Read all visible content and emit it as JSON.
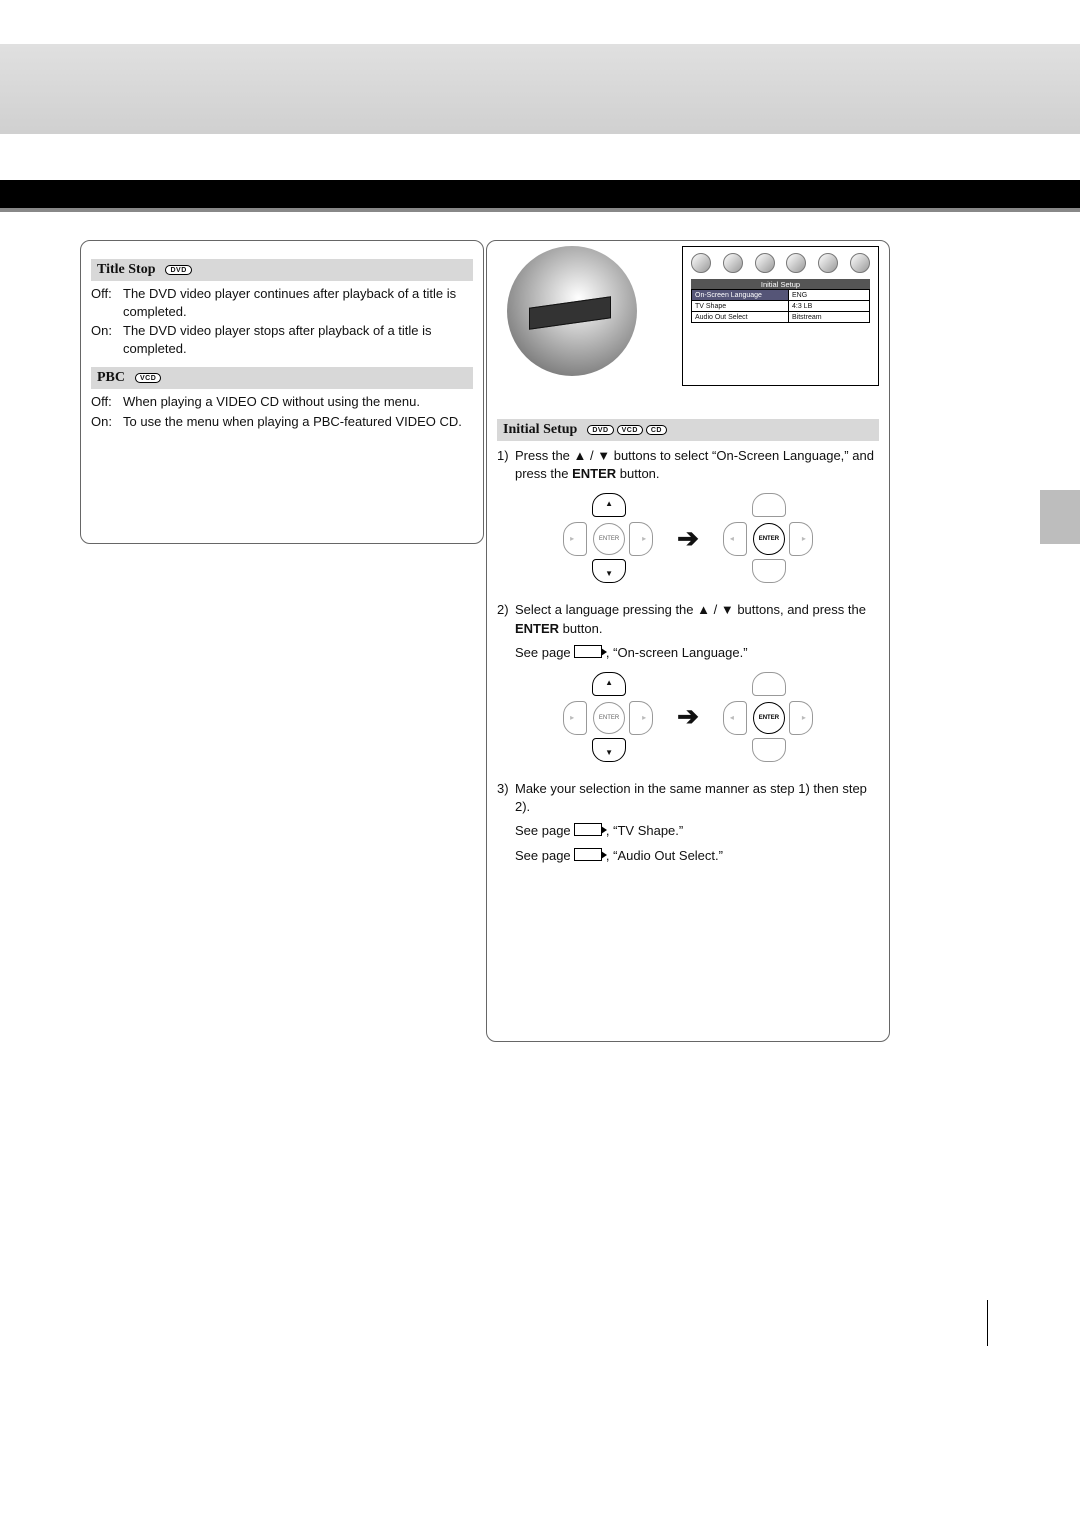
{
  "left": {
    "titleStop": {
      "label": "Title Stop",
      "badges": [
        "DVD"
      ],
      "off": "The DVD video player continues after playback of a title is completed.",
      "on": "The DVD video player stops after playback of a title is completed."
    },
    "pbc": {
      "label": "PBC",
      "badges": [
        "VCD"
      ],
      "off": "When playing a VIDEO CD without using the menu.",
      "on": "To use the menu when playing a PBC-featured VIDEO CD."
    }
  },
  "right": {
    "menu": {
      "title": "Initial Setup",
      "rows": [
        {
          "label": "On-Screen Language",
          "value": "ENG",
          "hl": true
        },
        {
          "label": "TV Shape",
          "value": "4:3 LB"
        },
        {
          "label": "Audio Out Select",
          "value": "Bitstream"
        }
      ]
    },
    "section": {
      "label": "Initial Setup",
      "badges": [
        "DVD",
        "VCD",
        "CD"
      ]
    },
    "step1": {
      "num": "1)",
      "pre": "Press the ",
      "mid": " buttons to select ",
      "item": "On-Screen Language,",
      "post": " and press the ",
      "btn": "ENTER",
      "tail": " button."
    },
    "step2": {
      "num": "2)",
      "pre": "Select a language pressing the ",
      "mid": " buttons, and press the ",
      "btn": "ENTER",
      "tail": " button.",
      "ref": "On-screen Language."
    },
    "step3": {
      "num": "3)",
      "text": "Make your selection in the same manner as step 1) then step 2).",
      "ref1": "TV Shape.",
      "ref2": "Audio Out Select."
    },
    "seePage": "See page ",
    "updown": "▲ / ▼",
    "enter": "ENTER"
  }
}
